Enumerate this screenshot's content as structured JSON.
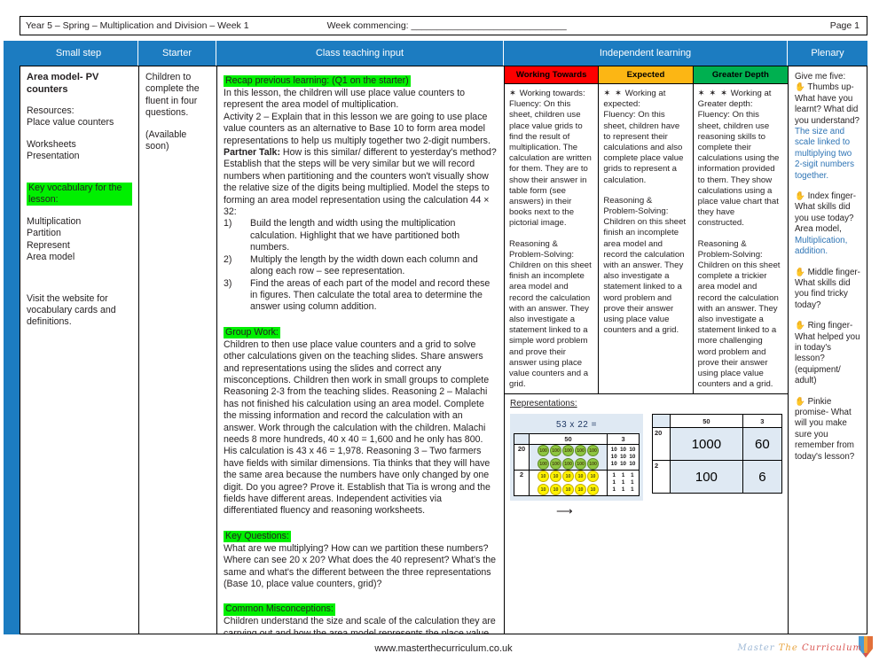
{
  "meta": {
    "left": "Year 5 – Spring – Multiplication and Division – Week 1",
    "week_commencing": "Week commencing: ______________________________",
    "page": "Page 1"
  },
  "headers": {
    "small_step": "Small step",
    "starter": "Starter",
    "class_teaching": "Class teaching input",
    "independent": "Independent learning",
    "plenary": "Plenary"
  },
  "small_step": {
    "title": "Area model- PV counters",
    "resources_label": "Resources:",
    "resources_1": "Place value counters",
    "resources_2": "Worksheets",
    "resources_3": "Presentation",
    "vocab_heading": "Key vocabulary for the lesson:",
    "vocab": [
      "Multiplication",
      "Partition",
      "Represent",
      "Area model"
    ],
    "website_note": "Visit the website for vocabulary cards and definitions."
  },
  "starter": {
    "line1": "Children to complete the fluent in four questions.",
    "line2": "(Available soon)"
  },
  "class_teaching": {
    "recap_heading": "Recap previous learning: (Q1 on the starter)",
    "recap_body": "In this lesson, the children will use place value counters to represent the area model of multiplication.",
    "activity": "Activity 2 – Explain that in this lesson we are going to use place value counters as an alternative to Base 10 to form area model representations to help us multiply together two 2-digit numbers.",
    "partner_talk_label": "Partner Talk:",
    "partner_talk_body": " How is this similar/ different to yesterday's method? Establish that the steps will be very similar but we will record numbers when partitioning and the counters won't visually show the relative size of the digits being multiplied. Model the steps to forming an area model representation using the calculation 44 × 32:",
    "steps": [
      {
        "n": "1)",
        "text": "Build the length and width using the multiplication calculation. Highlight that we have partitioned both numbers."
      },
      {
        "n": "2)",
        "text": "Multiply the length by the width down each column and along each row – see representation."
      },
      {
        "n": "3)",
        "text": "Find the areas of each part of the model and record these in figures. Then calculate the total area to determine the answer using column addition."
      }
    ],
    "group_work_heading": "Group Work:",
    "group_work_body": "Children to then use place value counters and a grid to solve other calculations given on the teaching slides. Share answers and representations using the slides and correct any misconceptions. Children then work in small groups to complete Reasoning 2-3 from the teaching slides. Reasoning 2 – Malachi has not finished his calculation using an area model. Complete the missing information and record the calculation with an answer. Work through the calculation with the children. Malachi needs 8 more hundreds, 40 x 40 = 1,600 and he only has 800. His calculation is 43 x 46 = 1,978.  Reasoning 3 – Two farmers have fields with similar dimensions. Tia thinks that they will have the same area because the numbers have only changed by one digit. Do you agree? Prove it. Establish that Tia is wrong and the fields have different areas. Independent activities via differentiated fluency and reasoning worksheets.",
    "key_questions_heading": "Key Questions:",
    "key_questions_body": "What are we multiplying? How can we partition these numbers? Where can see 20 x 20? What does the 40 represent? What's the same and what's the different between the three representations (Base 10, place value counters, grid)?",
    "misconceptions_heading": "Common Misconceptions:",
    "misconceptions_body": "Children understand the size and scale of the calculation they are carrying out and how the area model represents the place value of the partitioned digits in the calculation."
  },
  "independent": {
    "columns": [
      {
        "header": "Working Towards",
        "header_color": "#fe0000",
        "stars": "✶",
        "title": " Working towards:",
        "fluency": "Fluency: On this sheet, children use place value grids to find the result of multiplication. The calculation are written for them. They are to show their answer in table form (see answers) in their books next to the pictorial image.",
        "reasoning": "Reasoning & Problem-Solving: Children on this sheet finish an incomplete area model and record the calculation with an answer. They also investigate a statement linked to a simple word problem and prove their answer using place value counters and a grid."
      },
      {
        "header": "Expected",
        "header_color": "#fcb614",
        "stars": "✶ ✶",
        "title": " Working at expected:",
        "fluency": "Fluency: On this sheet, children have to represent their calculations and also complete place value grids to represent a calculation.",
        "reasoning": "Reasoning & Problem-Solving: Children on this sheet finish an incomplete area model and record the calculation with an answer. They also investigate a statement linked to a word problem and prove their answer using place value counters and a grid."
      },
      {
        "header": "Greater Depth",
        "header_color": "#00b050",
        "stars": "✶ ✶ ✶",
        "title": " Working at Greater depth:",
        "fluency": "Fluency: On this sheet, children use reasoning skills to complete their calculations using the information provided to them. They show calculations using a place value chart that they have constructed.",
        "reasoning": "Reasoning & Problem-Solving: Children on this sheet complete a trickier area model and record the calculation with an answer. They also investigate a statement linked to a more challenging word problem and prove their answer using place value counters and a grid."
      }
    ],
    "representations_label": "Representations:"
  },
  "representation": {
    "pv_grid": {
      "title": "53 x 22 =",
      "col_headers": [
        "50",
        "3"
      ],
      "row_headers": [
        "20",
        "2"
      ],
      "cells": [
        {
          "type": "counters",
          "color": "green",
          "value": "100",
          "rows": 2,
          "per_row": 5
        },
        {
          "type": "digits",
          "lines": [
            "10  10  10",
            "10  10  10",
            "10  10  10"
          ]
        },
        {
          "type": "counters",
          "color": "yellow",
          "value": "10",
          "rows": 2,
          "per_row": 5
        },
        {
          "type": "digits",
          "lines": [
            "1    1    1",
            "1    1    1",
            "1    1    1"
          ]
        }
      ]
    },
    "area_model": {
      "col_headers": [
        "50",
        "3"
      ],
      "row_headers": [
        "20",
        "2"
      ],
      "values": [
        [
          "1000",
          "60"
        ],
        [
          "100",
          "6"
        ]
      ]
    },
    "arrow": "⟶"
  },
  "plenary": {
    "intro": "Give me five:",
    "items": [
      {
        "icon": "✋",
        "prompt": "Thumbs up- What have you learnt? What did you understand?",
        "answer": "The size and scale linked to multiplying two 2-sigit numbers together."
      },
      {
        "icon": "✋",
        "prompt": "Index finger- What skills did you use today? Area model,",
        "answer": "Multiplication, addition."
      },
      {
        "icon": "✋",
        "prompt": "Middle finger- What skills did you find tricky today?",
        "answer": ""
      },
      {
        "icon": "✋",
        "prompt": "Ring finger- What helped you in today's lesson? (equipment/ adult)",
        "answer": ""
      },
      {
        "icon": "✋",
        "prompt": "Pinkie promise- What will you make sure you remember from today's lesson?",
        "answer": ""
      }
    ]
  },
  "footer": {
    "website": "www.masterthecurriculum.co.uk",
    "logo_word1": "Master",
    "logo_word2": "The",
    "logo_word3": "Curriculum"
  }
}
